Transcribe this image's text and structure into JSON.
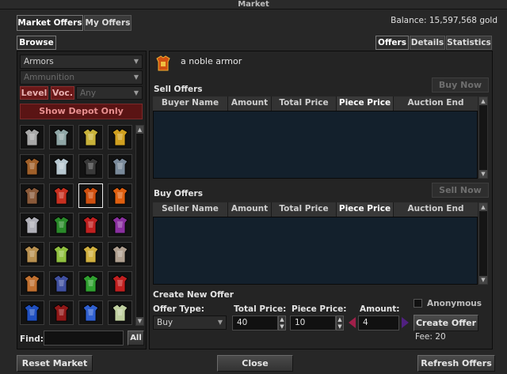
{
  "window": {
    "title": "Market"
  },
  "tabs": {
    "market_offers": "Market Offers",
    "my_offers": "My Offers",
    "browse": "Browse"
  },
  "balance": "Balance: 15,597,568 gold",
  "right_tabs": [
    "Offers",
    "Details",
    "Statistics"
  ],
  "filters": {
    "category": "Armors",
    "subcategory": "Ammunition",
    "level_label": "Level",
    "voc_label": "Voc.",
    "any_label": "Any",
    "show_depot_button": "Show Depot Only"
  },
  "item_grid": {
    "rows": 6,
    "cols": 4,
    "selected_index": 10,
    "items": [
      {
        "name": "plate-armor-icon",
        "color": "#a8a8a8"
      },
      {
        "name": "chain-armor-icon",
        "color": "#8fa6a6"
      },
      {
        "name": "golden-armor-icon",
        "color": "#c8b23a"
      },
      {
        "name": "magic-plate-armor-icon",
        "color": "#d0a020"
      },
      {
        "name": "leather-armor-icon",
        "color": "#a0602a"
      },
      {
        "name": "crystalline-armor-icon",
        "color": "#b8c8d0"
      },
      {
        "name": "dark-armor-icon",
        "color": "#3a3a3a"
      },
      {
        "name": "scale-armor-icon",
        "color": "#7a8a9a"
      },
      {
        "name": "brass-armor-icon",
        "color": "#8a5a3a"
      },
      {
        "name": "red-robe-icon",
        "color": "#c83020"
      },
      {
        "name": "noble-armor-icon",
        "color": "#d05010"
      },
      {
        "name": "fireborn-armor-icon",
        "color": "#e06010"
      },
      {
        "name": "skull-armor-icon",
        "color": "#b0b0b8"
      },
      {
        "name": "dragon-scale-mail-icon",
        "color": "#2a8a2a"
      },
      {
        "name": "demon-armor-icon",
        "color": "#c02020"
      },
      {
        "name": "royal-robe-icon",
        "color": "#8a30a0"
      },
      {
        "name": "bronze-armor-icon",
        "color": "#b89050"
      },
      {
        "name": "elven-mail-icon",
        "color": "#90c040"
      },
      {
        "name": "paladin-armor-icon",
        "color": "#d0b040"
      },
      {
        "name": "knight-armor-icon",
        "color": "#b0a090"
      },
      {
        "name": "tunic-icon",
        "color": "#c07030"
      },
      {
        "name": "blue-coat-icon",
        "color": "#4050a0"
      },
      {
        "name": "green-tunic-icon",
        "color": "#30a030"
      },
      {
        "name": "red-mail-icon",
        "color": "#c02020"
      },
      {
        "name": "blue-robe-icon",
        "color": "#2050c0"
      },
      {
        "name": "crimson-robe-icon",
        "color": "#901818"
      },
      {
        "name": "mage-robe-icon",
        "color": "#3060d0"
      },
      {
        "name": "elven-robe-icon",
        "color": "#c0d0a0"
      }
    ]
  },
  "find": {
    "label": "Find:",
    "value": "",
    "all_button": "All"
  },
  "selected_item": {
    "name": "a noble armor",
    "icon": "noble-armor-icon"
  },
  "sell_offers": {
    "title": "Sell Offers",
    "button": "Buy Now",
    "columns": [
      "Buyer Name",
      "Amount",
      "Total Price",
      "Piece Price",
      "Auction End"
    ],
    "sorted_column": "Piece Price"
  },
  "buy_offers": {
    "title": "Buy Offers",
    "button": "Sell Now",
    "columns": [
      "Seller Name",
      "Amount",
      "Total Price",
      "Piece Price",
      "Auction End"
    ],
    "sorted_column": "Piece Price"
  },
  "create_offer": {
    "title": "Create New Offer",
    "offer_type_label": "Offer Type:",
    "offer_type_value": "Buy",
    "total_price_label": "Total Price:",
    "total_price_value": "40",
    "piece_price_label": "Piece Price:",
    "piece_price_value": "10",
    "amount_label": "Amount:",
    "amount_value": "4",
    "anonymous_label": "Anonymous",
    "create_button": "Create Offer",
    "fee": "Fee: 20"
  },
  "footer": {
    "reset": "Reset Market",
    "close": "Close",
    "refresh": "Refresh Offers"
  },
  "colors": {
    "accent_red": "#8c1a1a",
    "highlight_slot": "#e8e8e8",
    "table_bg": "#13202c"
  }
}
